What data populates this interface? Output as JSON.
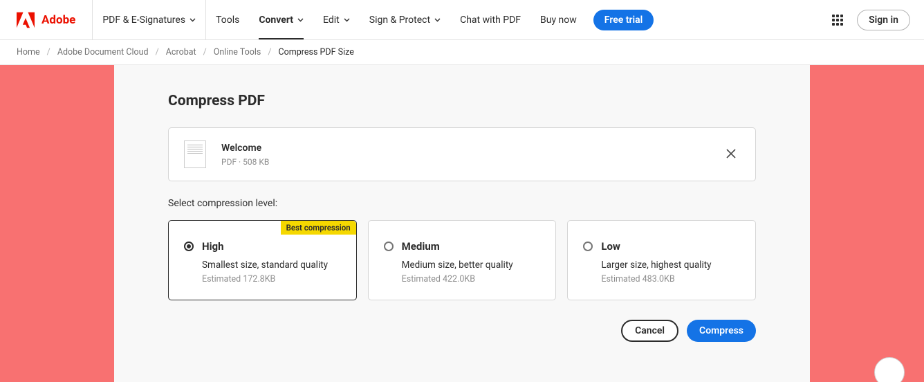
{
  "header": {
    "brand": "Adobe",
    "nav": [
      {
        "label": "PDF & E-Signatures",
        "dropdown": true,
        "active": false
      },
      {
        "label": "Tools",
        "dropdown": false,
        "active": false
      },
      {
        "label": "Convert",
        "dropdown": true,
        "active": true
      },
      {
        "label": "Edit",
        "dropdown": true,
        "active": false
      },
      {
        "label": "Sign & Protect",
        "dropdown": true,
        "active": false
      },
      {
        "label": "Chat with PDF",
        "dropdown": false,
        "active": false
      },
      {
        "label": "Buy now",
        "dropdown": false,
        "active": false
      }
    ],
    "free_trial": "Free trial",
    "sign_in": "Sign in"
  },
  "breadcrumb": {
    "items": [
      "Home",
      "Adobe Document Cloud",
      "Acrobat",
      "Online Tools"
    ],
    "current": "Compress PDF Size"
  },
  "main": {
    "title": "Compress PDF",
    "file": {
      "name": "Welcome",
      "meta": "PDF · 508 KB"
    },
    "section_label": "Select compression level:",
    "options": [
      {
        "title": "High",
        "desc": "Smallest size, standard quality",
        "estimated": "Estimated 172.8KB",
        "badge": "Best compression",
        "selected": true
      },
      {
        "title": "Medium",
        "desc": "Medium size, better quality",
        "estimated": "Estimated 422.0KB",
        "badge": null,
        "selected": false
      },
      {
        "title": "Low",
        "desc": "Larger size, highest quality",
        "estimated": "Estimated 483.0KB",
        "badge": null,
        "selected": false
      }
    ],
    "actions": {
      "cancel": "Cancel",
      "compress": "Compress"
    }
  }
}
